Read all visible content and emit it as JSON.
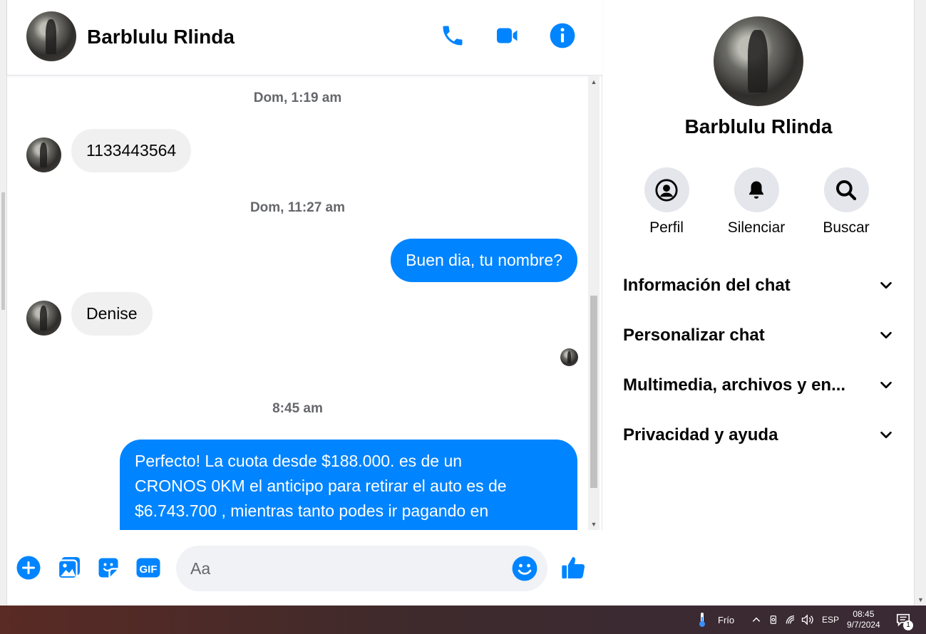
{
  "contact": {
    "name": "Barblulu Rlinda"
  },
  "header": {
    "call_icon": "phone-icon",
    "video_icon": "video-camera-icon",
    "info_icon": "info-icon"
  },
  "messages": {
    "ts1": "Dom, 1:19 am",
    "m1": "1133443564",
    "ts2": "Dom, 11:27 am",
    "m2": "Buen dia, tu nombre?",
    "m3": "Denise",
    "ts3": "8:45 am",
    "m4_line1": "Perfecto! La cuota desde $188.000. es de un",
    "m4_line2": "CRONOS 0KM el anticipo para retirar el auto es de",
    "m4_line3": "$6.743.700 , mientras tanto podes ir pagando en"
  },
  "composer": {
    "placeholder": "Aa"
  },
  "sidebar": {
    "name": "Barblulu Rlinda",
    "actions": [
      {
        "label": "Perfil"
      },
      {
        "label": "Silenciar"
      },
      {
        "label": "Buscar"
      }
    ],
    "sections": [
      {
        "label": "Información del chat"
      },
      {
        "label": "Personalizar chat"
      },
      {
        "label": "Multimedia, archivos y en..."
      },
      {
        "label": "Privacidad y ayuda"
      }
    ]
  },
  "taskbar": {
    "weather": "Frío",
    "language": "ESP",
    "time": "08:45",
    "date": "9/7/2024",
    "notifications": "1"
  },
  "colors": {
    "accent": "#0084ff",
    "incoming_bubble": "#f0f0f0"
  }
}
